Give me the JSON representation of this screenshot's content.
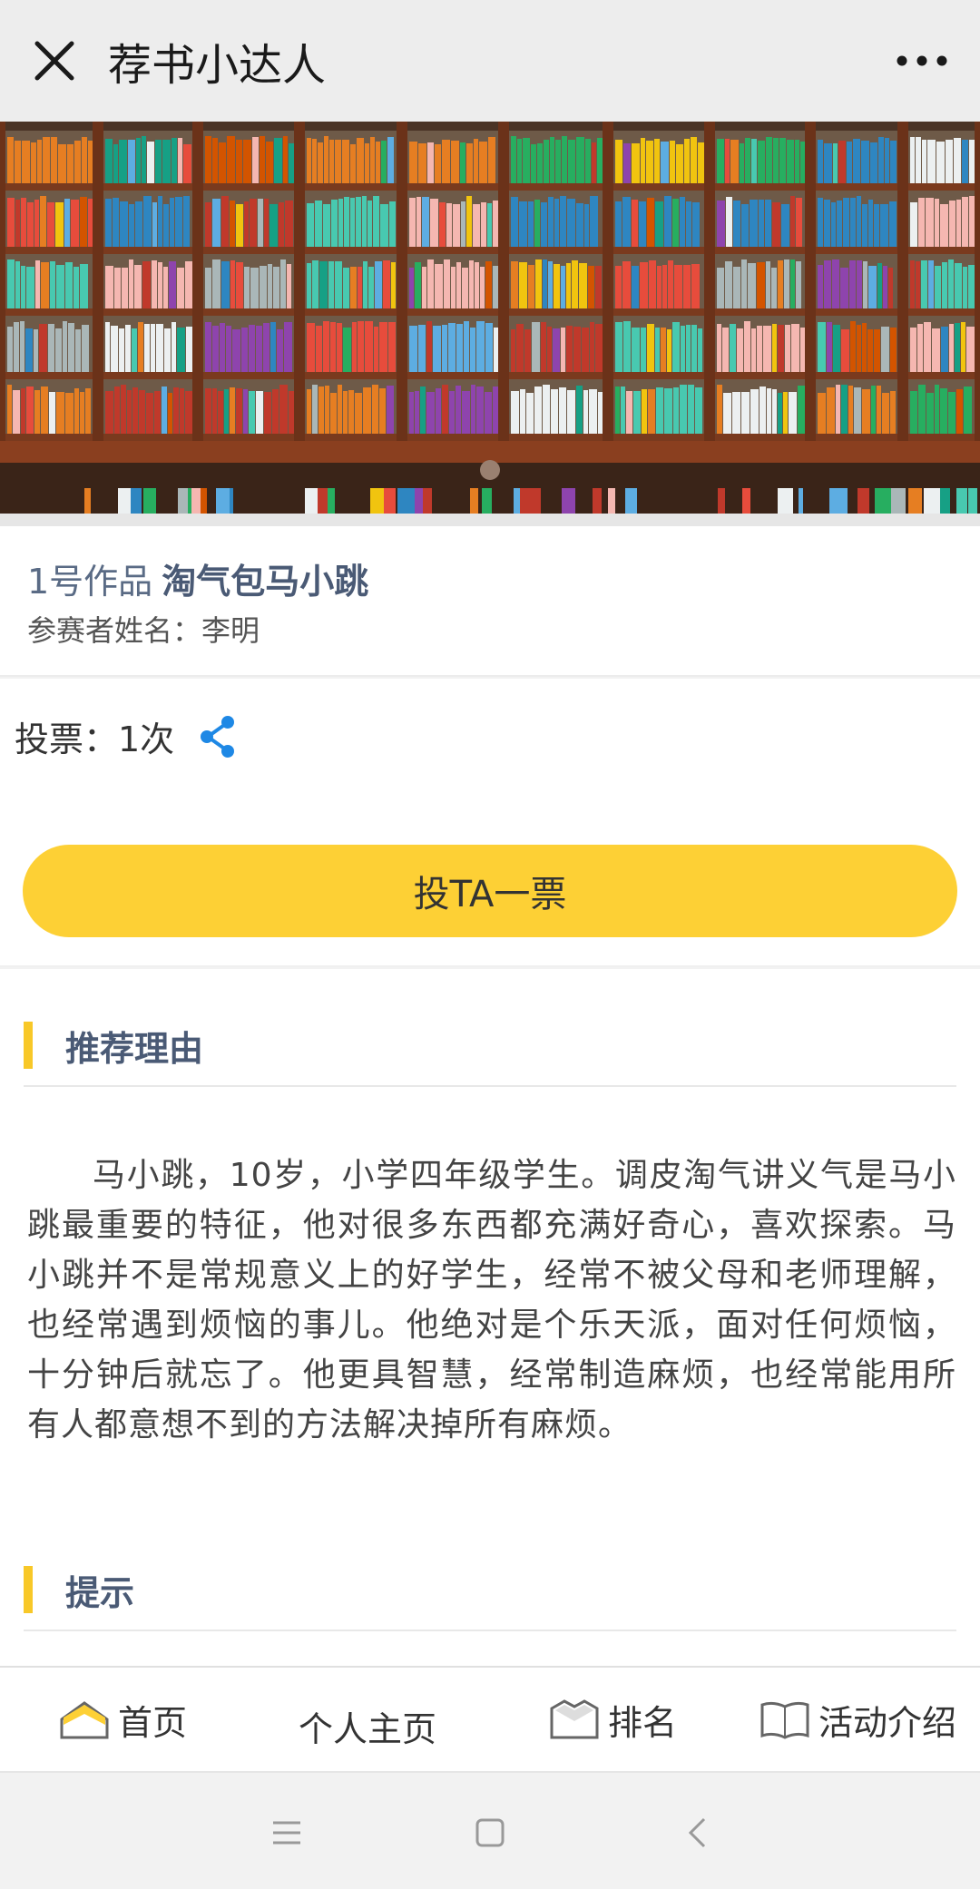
{
  "app": {
    "title": "荐书小达人"
  },
  "work": {
    "number_label": "1号作品",
    "name": "淘气包马小跳",
    "participant": "参赛者姓名：李明"
  },
  "votes": {
    "count_text": "投票：1次",
    "vote_button": "投TA一票"
  },
  "reason": {
    "title": "推荐理由",
    "text": "马小跳，10岁，小学四年级学生。调皮淘气讲义气是马小跳最重要的特征，他对很多东西都充满好奇心，喜欢探索。马小跳并不是常规意义上的好学生，经常不被父母和老师理解，也经常遇到烦恼的事儿。他绝对是个乐天派，面对任何烦恼，十分钟后就忘了。他更具智慧，经常制造麻烦，也经常能用所有人都意想不到的方法解决掉所有麻烦。"
  },
  "tip": {
    "title": "提示"
  },
  "nav": {
    "items": [
      {
        "label": "首页",
        "icon": "home-icon"
      },
      {
        "label": "个人主页",
        "icon": ""
      },
      {
        "label": "排名",
        "icon": "ranking-icon"
      },
      {
        "label": "活动介绍",
        "icon": "book-icon"
      }
    ]
  },
  "colors": {
    "accent_yellow": "#fdd035",
    "section_bar": "#f8c828",
    "link_blue": "#1e88e5",
    "title_text": "#4a5a75"
  }
}
